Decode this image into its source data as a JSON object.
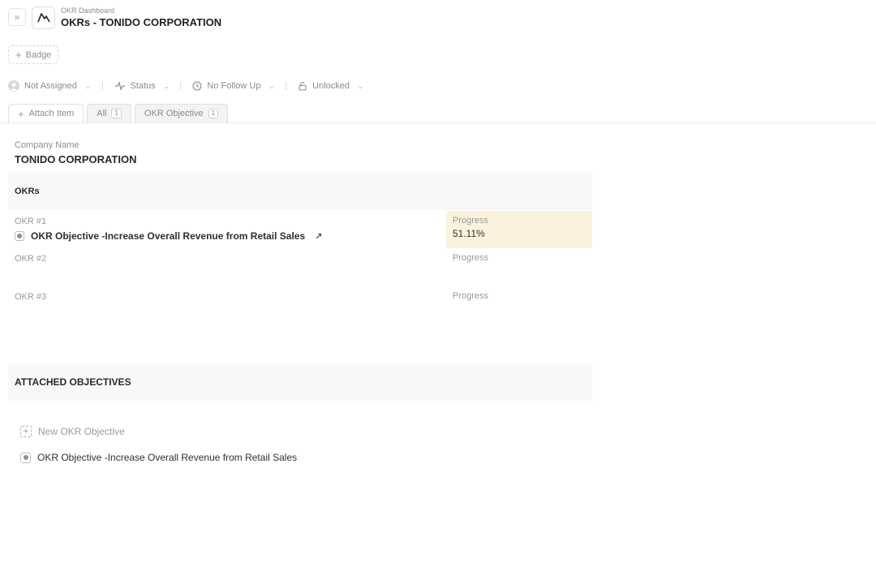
{
  "header": {
    "breadcrumb": "OKR Dashboard",
    "title": "OKRs - TONIDO CORPORATION",
    "expand_icon": "double-chevron-right-icon",
    "logo_icon": "mountain-icon"
  },
  "badge": {
    "label": "Badge"
  },
  "properties": {
    "assignee": "Not Assigned",
    "status": "Status",
    "follow_up": "No Follow Up",
    "lock": "Unlocked"
  },
  "tabs": [
    {
      "label": "Attach Item"
    },
    {
      "label": "All",
      "count": "1"
    },
    {
      "label": "OKR Objective",
      "count": "1"
    }
  ],
  "company": {
    "label": "Company Name",
    "value": "TONIDO CORPORATION"
  },
  "okrs": {
    "heading": "OKRs",
    "items": [
      {
        "label": "OKR #1",
        "objective": "OKR Objective -Increase Overall Revenue from Retail Sales",
        "progress_label": "Progress",
        "progress_value": "51.11%"
      },
      {
        "label": "OKR #2",
        "objective": "",
        "progress_label": "Progress",
        "progress_value": ""
      },
      {
        "label": "OKR #3",
        "objective": "",
        "progress_label": "Progress",
        "progress_value": ""
      }
    ]
  },
  "attached": {
    "heading": "ATTACHED OBJECTIVES",
    "new_label": "New OKR Objective",
    "items": [
      {
        "label": "OKR Objective -Increase Overall Revenue from Retail Sales"
      }
    ]
  },
  "colors": {
    "progress_highlight": "#faf2dc",
    "section_bg": "#f8f8f8"
  }
}
